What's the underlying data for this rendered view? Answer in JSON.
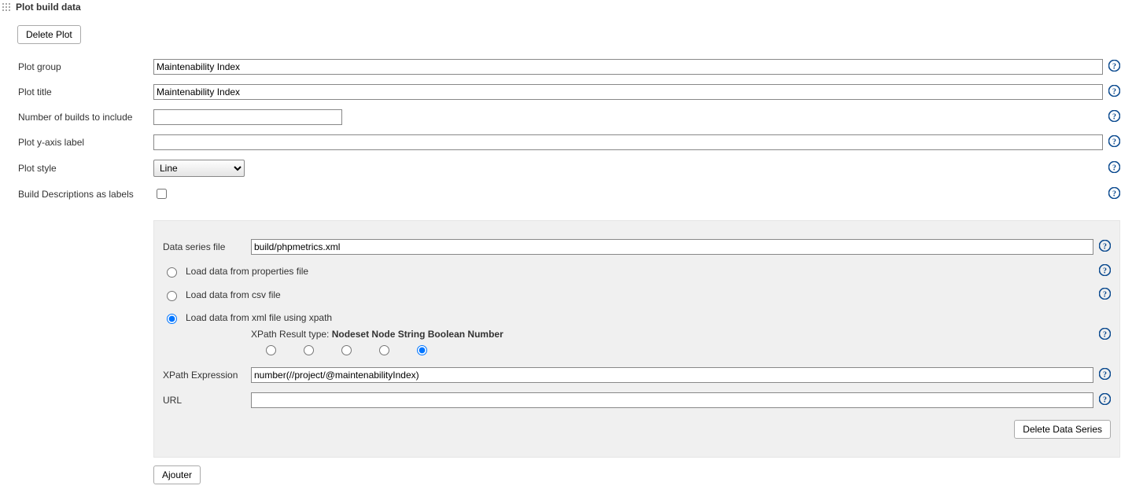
{
  "section_title": "Plot build data",
  "buttons": {
    "delete_plot": "Delete Plot",
    "delete_data_series": "Delete Data Series",
    "ajouter": "Ajouter"
  },
  "labels": {
    "plot_group": "Plot group",
    "plot_title": "Plot title",
    "num_builds": "Number of builds to include",
    "y_axis": "Plot y-axis label",
    "plot_style": "Plot style",
    "build_desc": "Build Descriptions as labels",
    "data_series_file": "Data series file",
    "load_properties": "Load data from properties file",
    "load_csv": "Load data from csv file",
    "load_xml": "Load data from xml file using xpath",
    "xpath_result_type": "XPath Result type:",
    "xpath_expression": "XPath Expression",
    "url": "URL"
  },
  "values": {
    "plot_group": "Maintenability Index",
    "plot_title": "Maintenability Index",
    "num_builds": "",
    "y_axis": "",
    "plot_style": "Line",
    "build_desc_checked": false,
    "data_series_file": "build/phpmetrics.xml",
    "load_mode": "xml",
    "xpath_type": "Number",
    "xpath_expression": "number(//project/@maintenabilityIndex)",
    "url": ""
  },
  "plot_style_options": [
    "Line"
  ],
  "xpath_types": [
    "Nodeset",
    "Node",
    "String",
    "Boolean",
    "Number"
  ]
}
